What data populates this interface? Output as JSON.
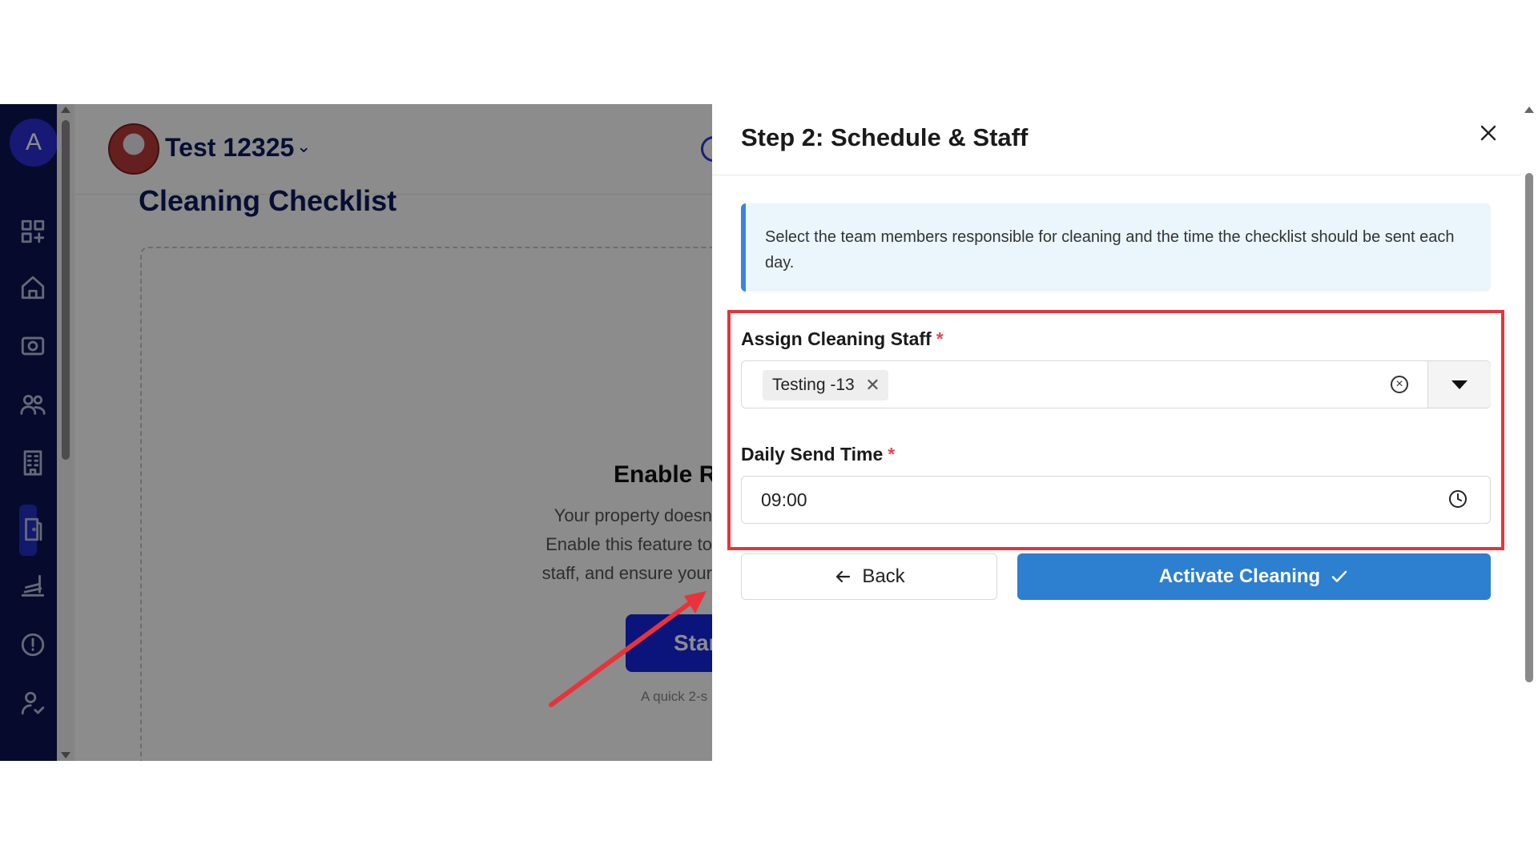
{
  "sidebar": {
    "avatar_letter": "A",
    "items": [
      {
        "icon": "grid-plus-icon"
      },
      {
        "icon": "home-icon"
      },
      {
        "icon": "camera-icon"
      },
      {
        "icon": "users-icon"
      },
      {
        "icon": "building-icon"
      },
      {
        "icon": "door-icon",
        "active": true
      },
      {
        "icon": "room-service-icon"
      },
      {
        "icon": "clock-alert-icon"
      },
      {
        "icon": "user-check-icon"
      }
    ]
  },
  "background_page": {
    "property_name": "Test 12325",
    "page_title": "Cleaning Checklist",
    "enable_title": "Enable R",
    "enable_description_lines": [
      "Your property doesn",
      "Enable this feature to",
      "staff, and ensure your"
    ],
    "start_button_label": "Star",
    "quick_text": "A quick 2-s"
  },
  "drawer": {
    "title": "Step 2: Schedule & Staff",
    "info_text": "Select the team members responsible for cleaning and the time the checklist should be sent each day.",
    "staff_field": {
      "label": "Assign Cleaning Staff",
      "required_mark": "*",
      "selected": [
        "Testing -13"
      ],
      "chip_remove_glyph": "✕",
      "clear_glyph": "×"
    },
    "time_field": {
      "label": "Daily Send Time",
      "required_mark": "*",
      "value": "09:00"
    },
    "back_button_label": "Back",
    "activate_button_label": "Activate Cleaning"
  },
  "colors": {
    "sidebar_bg": "#0b1452",
    "primary_blue": "#2d7fcf",
    "highlight_red": "#e8333a",
    "info_bg": "#eaf6fc",
    "info_border": "#3a86d6"
  }
}
